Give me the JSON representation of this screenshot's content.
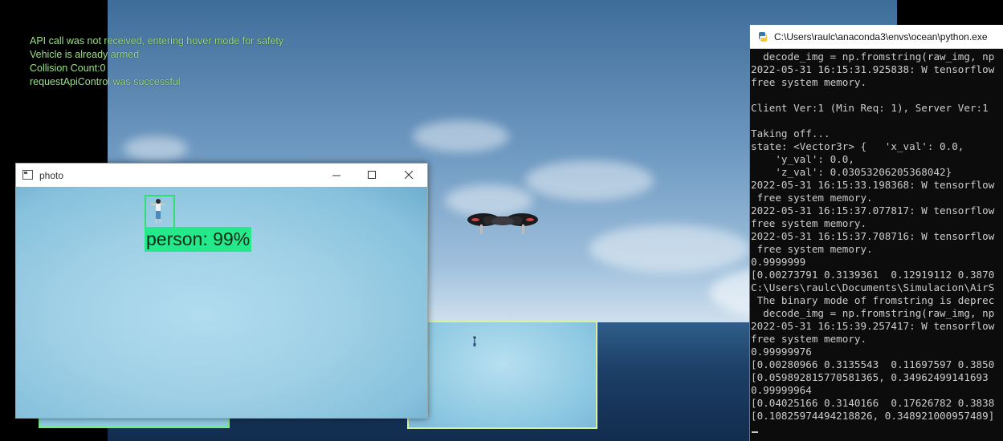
{
  "osd": {
    "lines": [
      "API call was not received, entering hover mode for safety",
      "Vehicle is already armed",
      "Collision Count:0",
      "requestApiControl was successful"
    ]
  },
  "photo_window": {
    "title": "photo",
    "icons": {
      "app": "image-window-icon",
      "minimize": "minimize-icon",
      "maximize": "maximize-icon",
      "close": "close-icon"
    },
    "detection": {
      "label": "person: 99%"
    },
    "colors": {
      "bbox": "#2fe070",
      "label_bg": "#25e88a"
    }
  },
  "console_window": {
    "title": "C:\\Users\\raulc\\anaconda3\\envs\\ocean\\python.exe",
    "icon": "python-icon",
    "lines": [
      "  decode_img = np.fromstring(raw_img, np",
      "2022-05-31 16:15:31.925838: W tensorflow",
      "free system memory.",
      "",
      "Client Ver:1 (Min Req: 1), Server Ver:1",
      "",
      "Taking off...",
      "state: <Vector3r> {   'x_val': 0.0,",
      "    'y_val': 0.0,",
      "    'z_val': 0.03053206205368042}",
      "2022-05-31 16:15:33.198368: W tensorflow",
      " free system memory.",
      "2022-05-31 16:15:37.077817: W tensorflow",
      "free system memory.",
      "2022-05-31 16:15:37.708716: W tensorflow",
      " free system memory.",
      "0.9999999",
      "[0.00273791 0.3139361  0.12919112 0.3870",
      "C:\\Users\\raulc\\Documents\\Simulacion\\AirS",
      " The binary mode of fromstring is deprec",
      "  decode_img = np.fromstring(raw_img, np",
      "2022-05-31 16:15:39.257417: W tensorflow",
      "free system memory.",
      "0.99999976",
      "[0.00280966 0.3135543  0.11697597 0.3850",
      "[0.059892815770581365, 0.34962499141693",
      "0.99999964",
      "[0.04025166 0.3140166  0.17626782 0.3838",
      "[0.10825974494218826, 0.348921000957489]"
    ]
  }
}
